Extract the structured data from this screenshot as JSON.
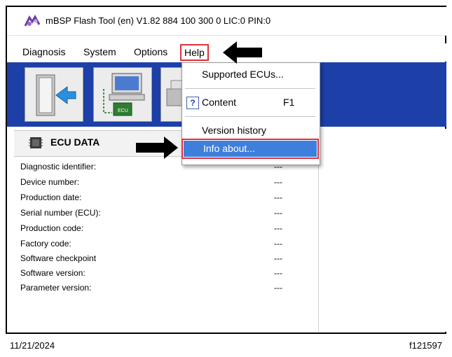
{
  "window": {
    "title": "mBSP Flash Tool (en) V1.82  884 100 300 0  LIC:0 PIN:0",
    "app_icon": "mbsp-logo-icon"
  },
  "menubar": {
    "items": [
      {
        "label": "Diagnosis"
      },
      {
        "label": "System"
      },
      {
        "label": "Options"
      },
      {
        "label": "Help"
      }
    ]
  },
  "toolbar": {
    "background": "#1c3fa8",
    "buttons": [
      {
        "icon": "exit-door-icon"
      },
      {
        "icon": "ecu-computer-icon"
      },
      {
        "icon": "printer-icon"
      }
    ]
  },
  "help_menu": {
    "items": [
      {
        "label": "Supported ECUs..."
      },
      {
        "label": "Content",
        "shortcut": "F1",
        "icon": "help-question-icon",
        "icon_glyph": "?"
      },
      {
        "label": "Version history"
      },
      {
        "label": "Info about..."
      }
    ],
    "highlight_color": "#3f7fdc",
    "annotation_color": "#e0303a"
  },
  "ecu_panel": {
    "title": "ECU DATA",
    "icon": "ecu-chip-icon",
    "rows": [
      {
        "label": "Diagnostic identifier:",
        "value": "---"
      },
      {
        "label": "Device number:",
        "value": "---"
      },
      {
        "label": "Production date:",
        "value": "---"
      },
      {
        "label": "Serial number (ECU):",
        "value": "---"
      },
      {
        "label": "Production code:",
        "value": "---"
      },
      {
        "label": "Factory code:",
        "value": "---"
      },
      {
        "label": "Software checkpoint",
        "value": "---"
      },
      {
        "label": "Software version:",
        "value": "---"
      },
      {
        "label": "Parameter version:",
        "value": "---"
      }
    ]
  },
  "footer": {
    "date": "11/21/2024",
    "figure_id": "f121597"
  }
}
